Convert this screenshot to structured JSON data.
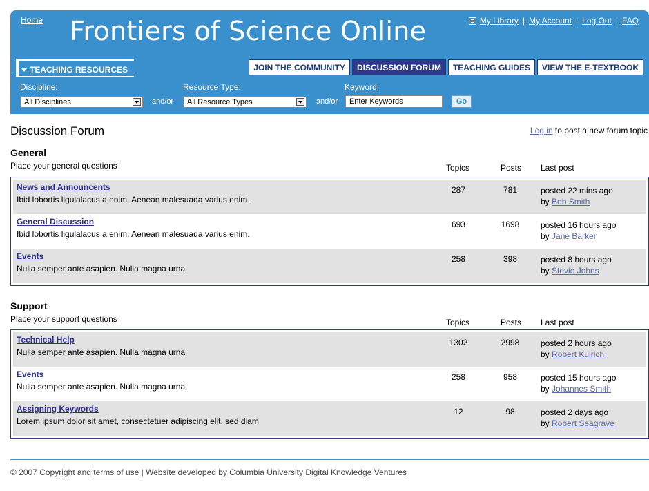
{
  "header": {
    "home": "Home",
    "title": "Frontiers of Science Online",
    "links": [
      "My Library",
      "My Account",
      "Log Out",
      "FAQ"
    ],
    "separator": "|"
  },
  "nav": {
    "teaching_resources": "TEACHING RESOURCES",
    "tabs": [
      "JOIN THE COMMUNITY",
      "DISCUSSION FORUM",
      "TEACHING GUIDES",
      "VIEW THE E-TEXTBOOK"
    ],
    "active_tab": "DISCUSSION FORUM"
  },
  "filters": {
    "discipline_label": "Discipline:",
    "discipline_value": "All Disciplines",
    "resource_label": "Resource Type:",
    "resource_value": "All Resource Types",
    "keyword_label": "Keyword:",
    "keyword_value": "Enter Keywords",
    "andor": "and/or",
    "go": "Go"
  },
  "main": {
    "title": "Discussion Forum",
    "login_link": "Log in",
    "login_text": " to post a new forum topic"
  },
  "columns": {
    "topics": "Topics",
    "posts": "Posts",
    "last": "Last post"
  },
  "sections": [
    {
      "title": "General",
      "desc": "Place your general questions",
      "rows": [
        {
          "title": "News and Announcents",
          "desc": "Ibid lobortis ligulalacus a enim. Aenean malesuada varius enim.",
          "topics": "287",
          "posts": "781",
          "when": "posted 22 mins ago",
          "by": "by ",
          "author": "Bob Smith"
        },
        {
          "title": "General Discussion",
          "desc": "Ibid lobortis ligulalacus a enim. Aenean malesuada varius enim.",
          "topics": "693",
          "posts": "1698",
          "when": "posted 16 hours ago",
          "by": "by ",
          "author": "Jane Barker"
        },
        {
          "title": "Events",
          "desc": "Nulla semper ante asapien. Nulla magna urna",
          "topics": "258",
          "posts": "398",
          "when": "posted 8 hours ago",
          "by": "by ",
          "author": "Stevie Johns"
        }
      ]
    },
    {
      "title": "Support",
      "desc": "Place your support questions",
      "rows": [
        {
          "title": "Technical Help",
          "desc": "Nulla semper ante asapien. Nulla magna urna",
          "topics": "1302",
          "posts": "2998",
          "when": "posted 2 hours ago",
          "by": "by ",
          "author": "Robert Kulrich"
        },
        {
          "title": "Events",
          "desc": "Nulla semper ante asapien. Nulla magna urna",
          "topics": "258",
          "posts": "958",
          "when": "posted 15 hours ago",
          "by": "by ",
          "author": "Johannes Smith"
        },
        {
          "title": "Assigning Keywords",
          "desc": "Lorem ipsum dolor sit amet, consectetuer adipiscing elit, sed diam",
          "topics": "12",
          "posts": "98",
          "when": "posted 2 days ago",
          "by": "by ",
          "author": "Robert Seagrave"
        }
      ]
    }
  ],
  "footer": {
    "copyright": "© 2007 Copyright and ",
    "terms": "terms of use",
    "developed": " | Website developed by ",
    "developer": "Columbia University Digital Knowledge Ventures"
  },
  "colors": {
    "header_blue": "#3a90cc",
    "nav_dark": "#2b3a8c",
    "row_shade": "#e2e2e2"
  }
}
